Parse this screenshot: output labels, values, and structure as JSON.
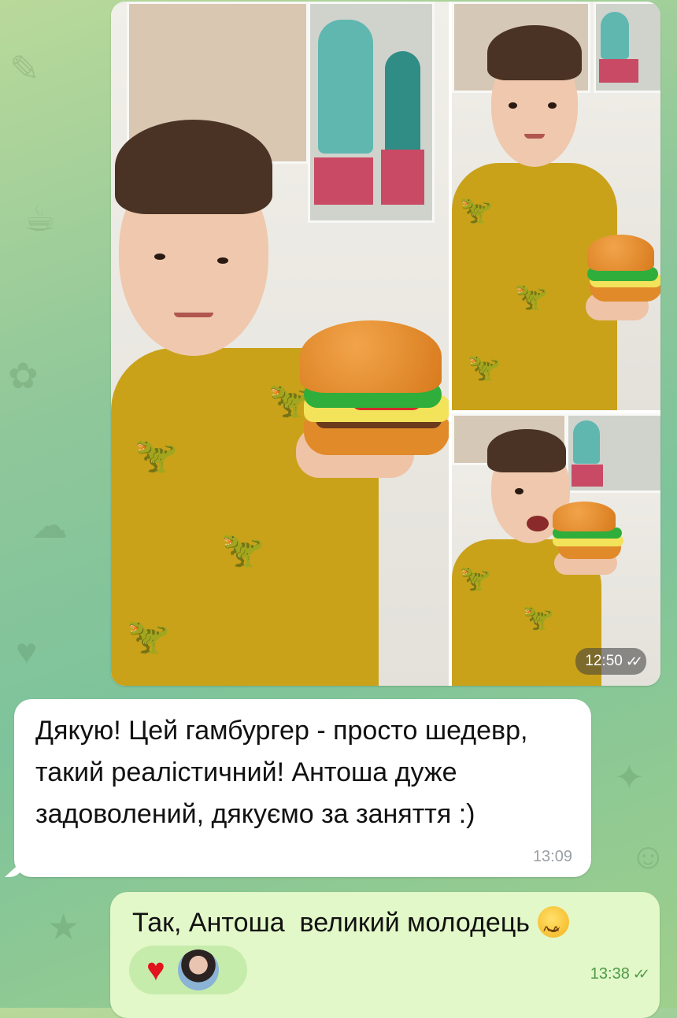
{
  "album": {
    "time": "12:50",
    "status_icon": "double-check-icon",
    "photos": [
      {
        "name": "boy-holding-burger-large"
      },
      {
        "name": "boy-holding-burger-small"
      },
      {
        "name": "boy-biting-burger"
      }
    ]
  },
  "incoming": {
    "text": "Дякую! Цей гамбургер - просто шедевр, такий реалістичний! Антоша дуже задоволений, дякуємо за заняття :)",
    "time": "13:09"
  },
  "outgoing": {
    "text": "Так, Антоша  великий молодець",
    "emoji": "smiling-face-emoji",
    "reaction": "heart-icon",
    "time": "13:38",
    "status_icon": "double-check-icon"
  },
  "colors": {
    "incoming_bubble": "#ffffff",
    "outgoing_bubble": "#e2f8c8",
    "reaction_heart": "#e0141d",
    "time_green": "#4f9a4a"
  }
}
